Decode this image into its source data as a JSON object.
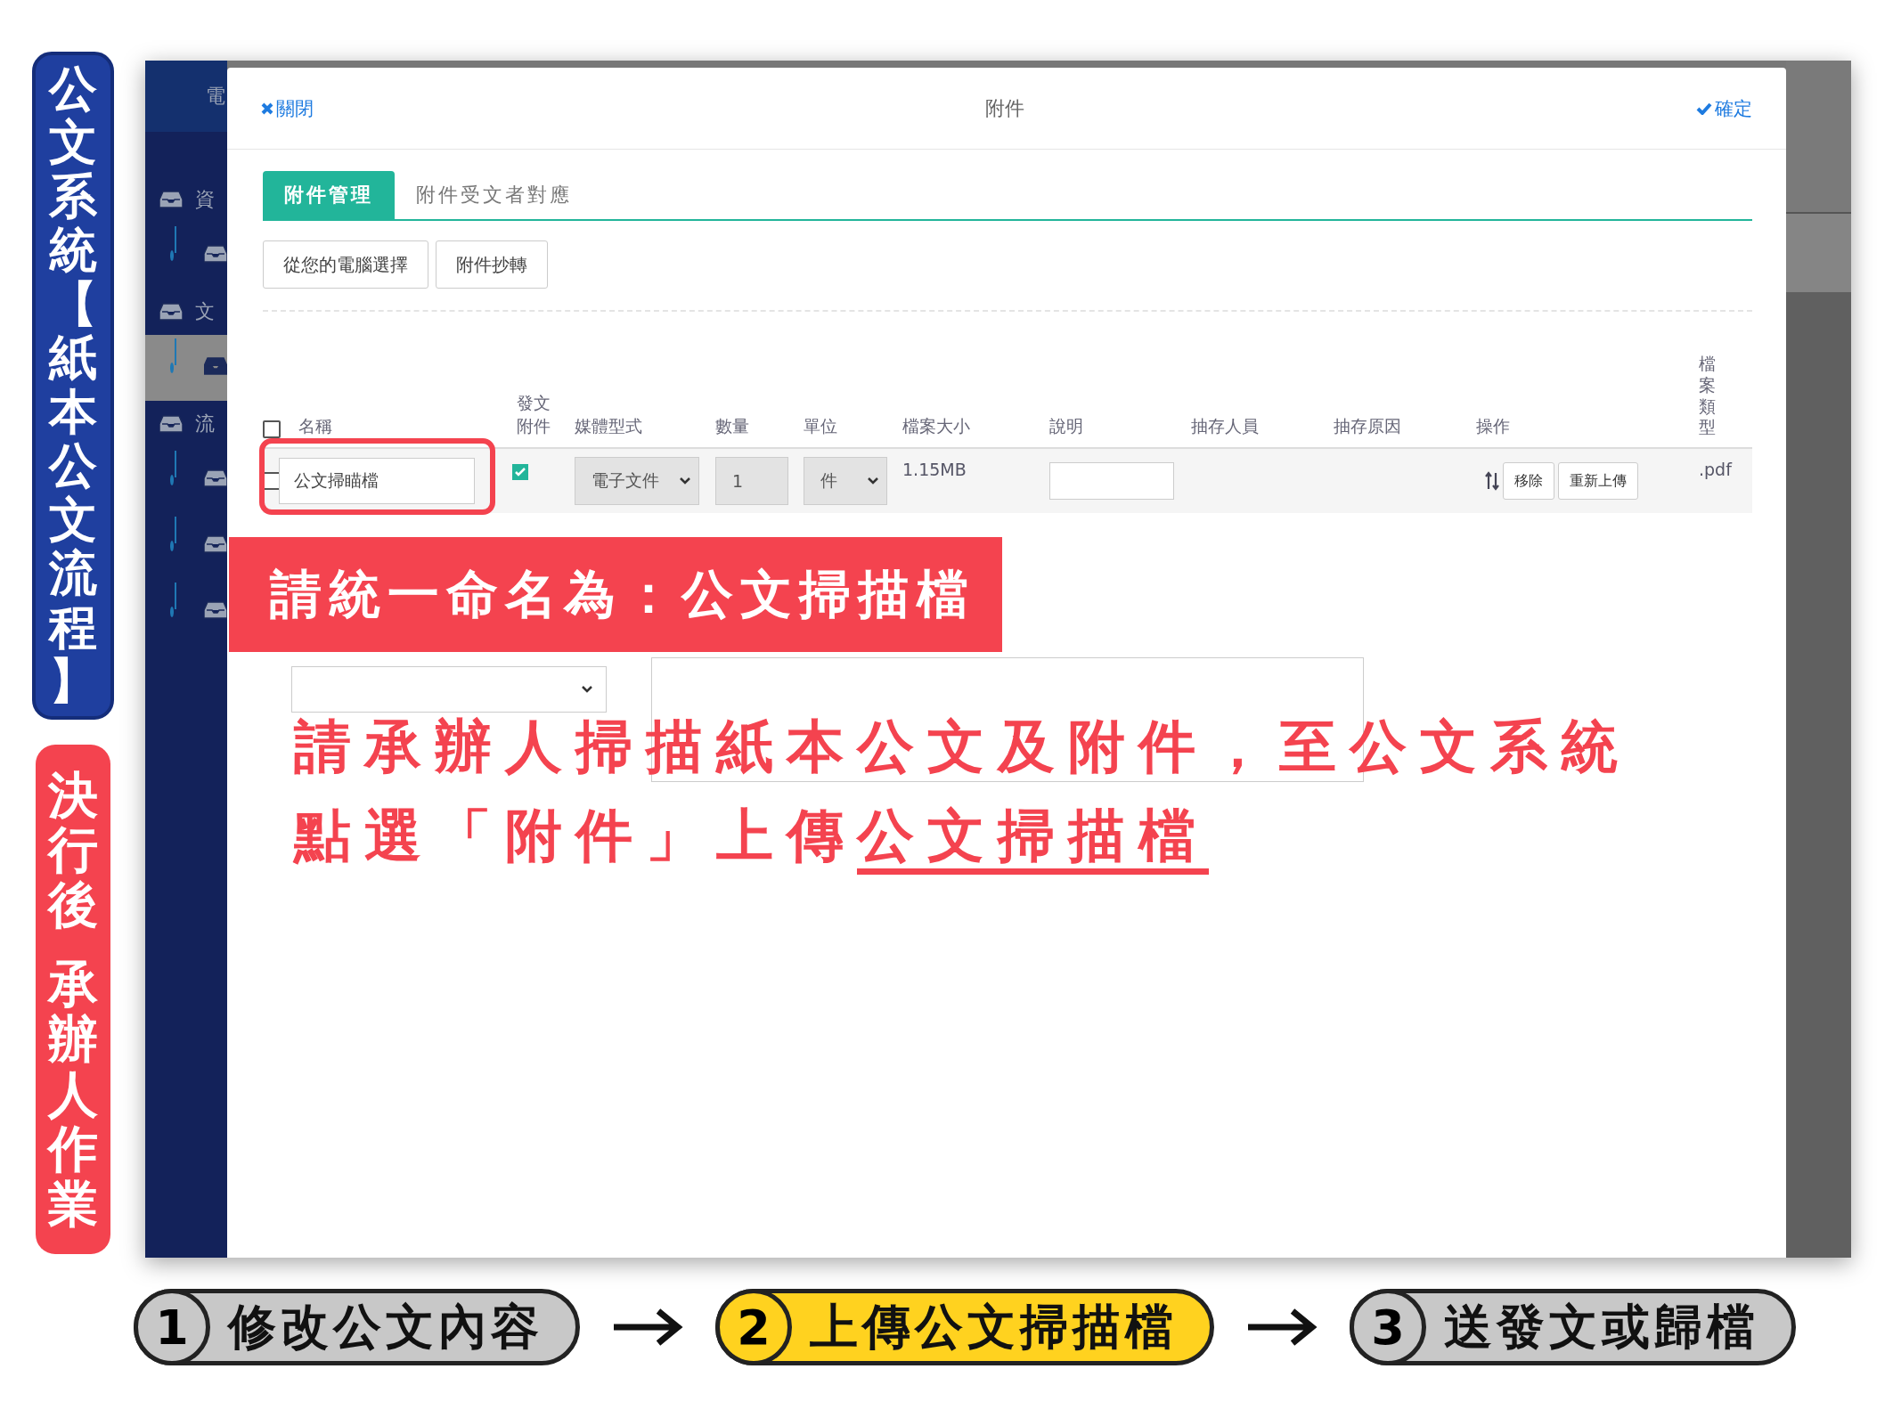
{
  "title_banner": {
    "text": "公文系統【紙本公文流程】"
  },
  "stage_badge": {
    "parts": [
      "決行後",
      "承辦人作業"
    ]
  },
  "app": {
    "header_text": "電",
    "sidebar": [
      {
        "kind": "section",
        "label": "資"
      },
      {
        "kind": "sub",
        "selected": false
      },
      {
        "kind": "section",
        "label": "文"
      },
      {
        "kind": "sub",
        "selected": true
      },
      {
        "kind": "section",
        "label": "流"
      },
      {
        "kind": "sub",
        "selected": false
      },
      {
        "kind": "sub",
        "selected": false
      },
      {
        "kind": "sub",
        "selected": false
      }
    ],
    "modal": {
      "close": "關閉",
      "title": "附件",
      "confirm": "確定",
      "tabs": [
        {
          "label": "附件管理",
          "selected": true
        },
        {
          "label": "附件受文者對應",
          "selected": false
        }
      ],
      "buttons": [
        "從您的電腦選擇",
        "附件抄轉"
      ],
      "table": {
        "select_all": false,
        "columns": [
          "名稱",
          "發文附件",
          "媒體型式",
          "數量",
          "單位",
          "檔案大小",
          "說明",
          "抽存人員",
          "抽存原因",
          "操作",
          "檔案類型"
        ],
        "rows": [
          {
            "checked": false,
            "name": "公文掃瞄檔",
            "attachment": true,
            "media": "電子文件",
            "quantity": "1",
            "unit": "件",
            "size": "1.15MB",
            "actions": [
              "移除",
              "重新上傳"
            ],
            "file_type": ".pdf"
          }
        ]
      }
    }
  },
  "annotations": {
    "naming_banner": "請統一命名為：公文掃描檔",
    "instruction_lines": [
      "請承辦人掃描紙本公文及附件，至公文系統",
      "點選「附件」上傳"
    ],
    "instruction_highlight": "公文掃描檔"
  },
  "steps": [
    {
      "number": "1",
      "label": "修改公文內容",
      "selected": false
    },
    {
      "number": "2",
      "label": "上傳公文掃描檔",
      "selected": true
    },
    {
      "number": "3",
      "label": "送發文或歸檔",
      "selected": false
    }
  ]
}
